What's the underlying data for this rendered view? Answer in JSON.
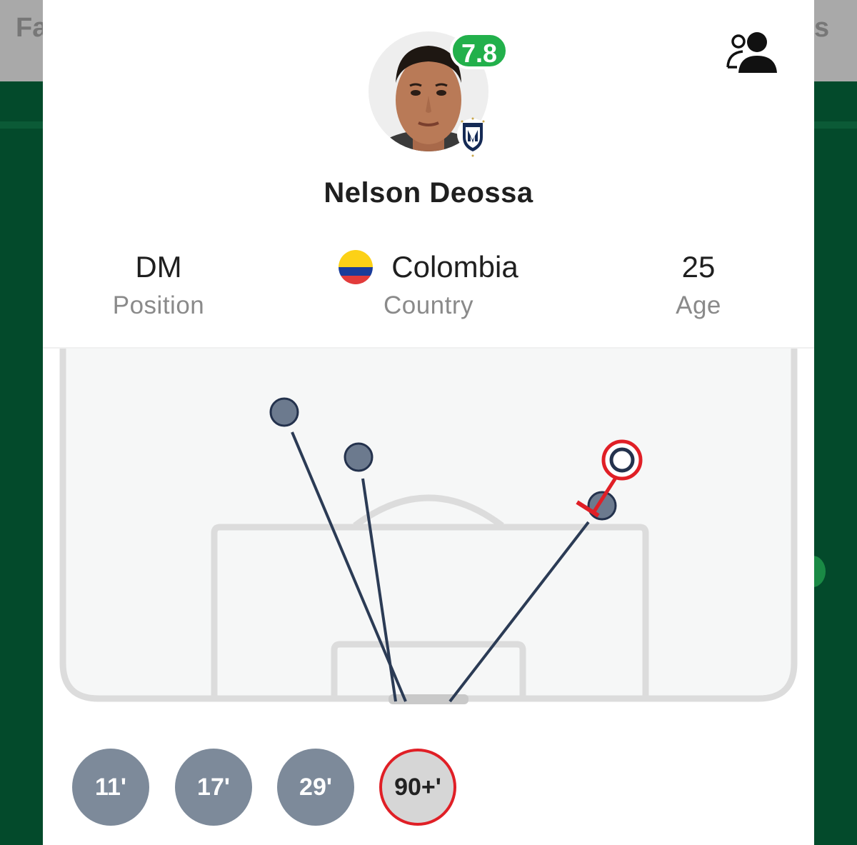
{
  "background": {
    "left_fragment": "Fa",
    "right_fragment": "s"
  },
  "player": {
    "name": "Nelson Deossa",
    "rating": "7.8",
    "rating_color": "#22b04b"
  },
  "stats": {
    "position": {
      "value": "DM",
      "label": "Position"
    },
    "country": {
      "value": "Colombia",
      "label": "Country"
    },
    "age": {
      "value": "25",
      "label": "Age"
    }
  },
  "shot_map": {
    "shots": [
      {
        "minute": "11'",
        "outcome": "blocked"
      },
      {
        "minute": "17'",
        "outcome": "off-target"
      },
      {
        "minute": "29'",
        "outcome": "off-target"
      },
      {
        "minute": "90+'",
        "outcome": "blocked",
        "selected": true
      }
    ],
    "selected_color": "#e01f26",
    "shot_color": "#7d8a9a",
    "line_color": "#2b3b55"
  }
}
